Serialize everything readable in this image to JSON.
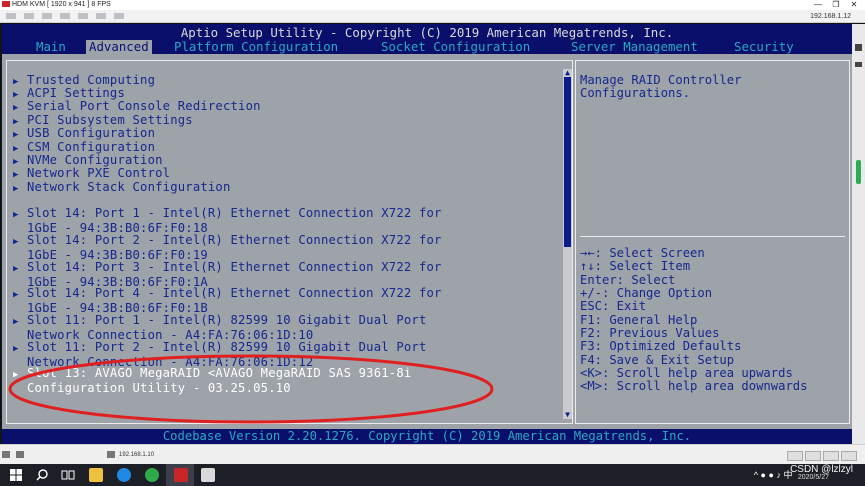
{
  "viewer": {
    "title": "HDM KVM  [ 1920 x 941 ]  8 FPS",
    "ip": "192.168.1.12",
    "status_ip": "192.168.1.10"
  },
  "bios": {
    "title": "Aptio Setup Utility - Copyright (C) 2019 American Megatrends, Inc.",
    "tabs": [
      "Main",
      "Advanced",
      "Platform Configuration",
      "Socket Configuration",
      "Server Management",
      "Security"
    ],
    "active_tab": "Advanced",
    "items": [
      "Trusted Computing",
      "ACPI Settings",
      "Serial Port Console Redirection",
      "PCI Subsystem Settings",
      "USB Configuration",
      "CSM Configuration",
      "NVMe Configuration",
      "Network PXE Control",
      "Network Stack Configuration"
    ],
    "devices": [
      {
        "l1": "Slot 14: Port 1 - Intel(R) Ethernet Connection X722 for",
        "l2": "1GbE - 94:3B:B0:6F:F0:18"
      },
      {
        "l1": "Slot 14: Port 2 - Intel(R) Ethernet Connection X722 for",
        "l2": "1GbE - 94:3B:B0:6F:F0:19"
      },
      {
        "l1": "Slot 14: Port 3 - Intel(R) Ethernet Connection X722 for",
        "l2": "1GbE - 94:3B:B0:6F:F0:1A"
      },
      {
        "l1": "Slot 14: Port 4 - Intel(R) Ethernet Connection X722 for",
        "l2": "1GbE - 94:3B:B0:6F:F0:1B"
      },
      {
        "l1": "Slot 11: Port 1 - Intel(R) 82599 10 Gigabit Dual Port",
        "l2": "Network Connection - A4:FA:76:06:1D:10"
      },
      {
        "l1": "Slot 11: Port 2 - Intel(R) 82599 10 Gigabit Dual Port",
        "l2": "Network Connection - A4:FA:76:06:1D:12"
      },
      {
        "l1": "Slot 13: AVAGO MegaRAID <AVAGO MegaRAID SAS 9361-8i",
        "l2": "Configuration Utility - 03.25.05.10"
      }
    ],
    "help_text": [
      "Manage RAID Controller",
      "Configurations."
    ],
    "keys": [
      "→←: Select Screen",
      "↑↓: Select Item",
      "Enter: Select",
      "+/-: Change Option",
      "ESC: Exit",
      "F1: General Help",
      "F2: Previous Values",
      "F3: Optimized Defaults",
      "F4: Save & Exit Setup",
      "<K>: Scroll help area upwards",
      "<M>: Scroll help area downwards"
    ],
    "footer": "Codebase Version 2.20.1276. Copyright (C) 2019 American Megatrends, Inc."
  },
  "taskbar": {
    "time": "2020/5/27",
    "watermark": "CSDN @lzlzyl",
    "lang": "中"
  },
  "colors": {
    "bios_blue": "#0a0f6c",
    "panel_gray": "#9ea2a9",
    "item_blue": "#16288e",
    "tab_cyan": "#29a9c1",
    "annotation_red": "#e02020"
  }
}
